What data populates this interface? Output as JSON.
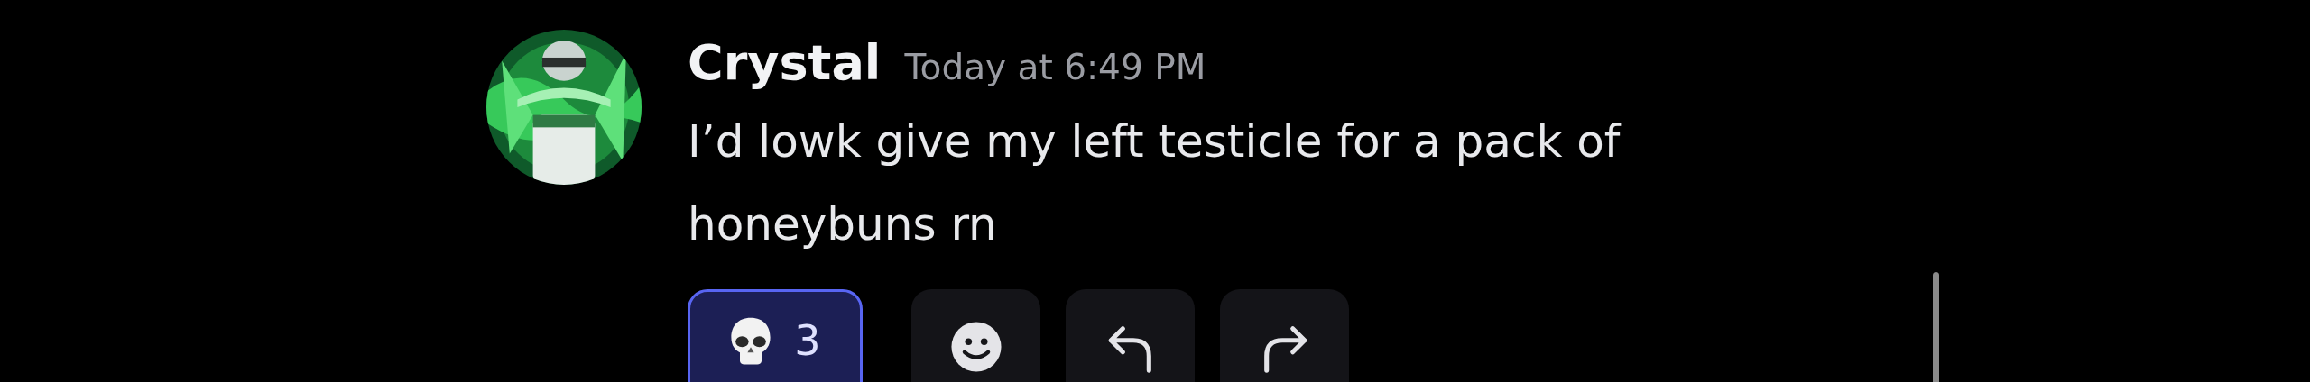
{
  "message": {
    "author": "Crystal",
    "timestamp": "Today at 6:49 PM",
    "text": "I’d lowk give my left testicle for a pack of honeybuns rn"
  },
  "reactions": [
    {
      "count": "3",
      "selected": true
    }
  ],
  "actions": [
    {
      "kind": "emoji"
    },
    {
      "kind": "reply"
    },
    {
      "kind": "forward"
    }
  ]
}
